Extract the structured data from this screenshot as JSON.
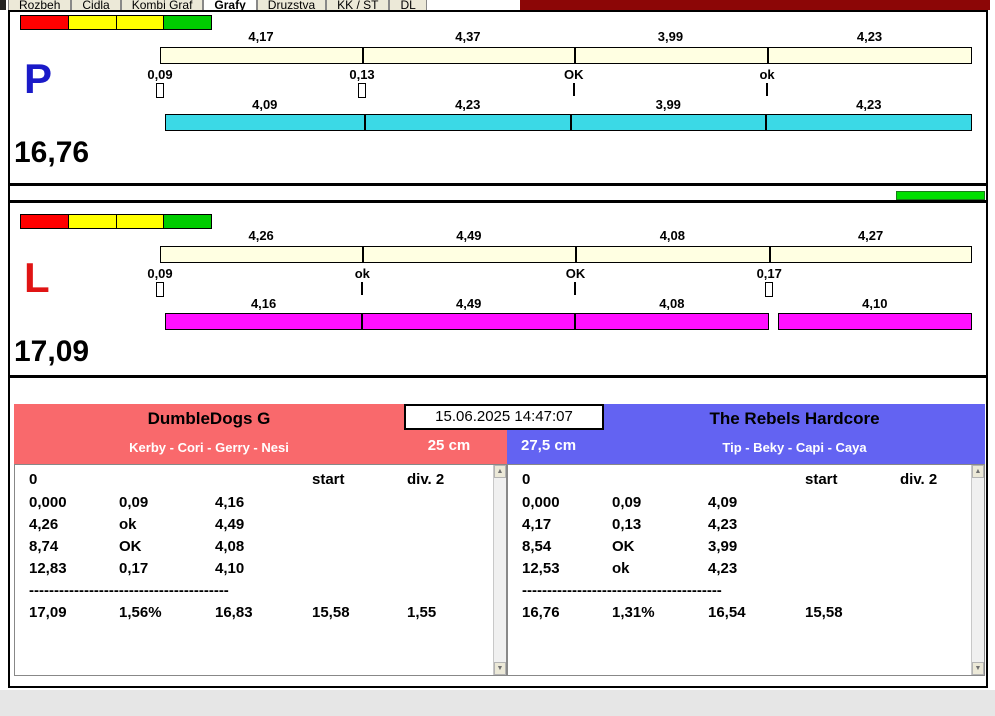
{
  "tabs": [
    {
      "label": "Rozbeh",
      "active": false
    },
    {
      "label": "Cidla",
      "active": false
    },
    {
      "label": "Kombi Graf",
      "active": false
    },
    {
      "label": "Grafy",
      "active": true
    },
    {
      "label": "Druzstva",
      "active": false
    },
    {
      "label": "KK / ST",
      "active": false
    },
    {
      "label": "DL",
      "active": false
    }
  ],
  "legend_colors": [
    "#ff0000",
    "#ffff00",
    "#ffff00",
    "#00cc00"
  ],
  "green_bar_color": "#00df00",
  "icons": {
    "scroll_up": "▲",
    "scroll_down": "▼"
  },
  "panels": [
    {
      "letter": "P",
      "letter_color": "#1a1ac8",
      "total": "16,76",
      "top_values": [
        "4,17",
        "4,37",
        "3,99",
        "4,23"
      ],
      "top_numeric": [
        4.17,
        4.37,
        3.99,
        4.23
      ],
      "top_bar_color": "#ffffe2",
      "marks": [
        {
          "label": "0,09",
          "glyph": "box"
        },
        {
          "label": "0,13",
          "glyph": "box"
        },
        {
          "label": "OK",
          "glyph": "line"
        },
        {
          "label": "ok",
          "glyph": "line"
        }
      ],
      "bottom_values": [
        "4,09",
        "4,23",
        "3,99",
        "4,23"
      ],
      "bottom_numeric": [
        4.09,
        4.23,
        3.99,
        4.23
      ],
      "bottom_bar_color": "#3bd9e6",
      "bottom_gap_after": -1
    },
    {
      "letter": "L",
      "letter_color": "#e01414",
      "total": "17,09",
      "top_values": [
        "4,26",
        "4,49",
        "4,08",
        "4,27"
      ],
      "top_numeric": [
        4.26,
        4.49,
        4.08,
        4.27
      ],
      "top_bar_color": "#ffffe2",
      "marks": [
        {
          "label": "0,09",
          "glyph": "box"
        },
        {
          "label": "ok",
          "glyph": "line"
        },
        {
          "label": "OK",
          "glyph": "line"
        },
        {
          "label": "0,17",
          "glyph": "box"
        }
      ],
      "bottom_values": [
        "4,16",
        "4,49",
        "4,08",
        "4,10"
      ],
      "bottom_numeric": [
        4.16,
        4.49,
        4.08,
        4.1
      ],
      "bottom_bar_color": "#ff10ff",
      "bottom_gap_after": 2
    }
  ],
  "timestamp": "15.06.2025 14:47:07",
  "teams": {
    "left": {
      "name": "DumbleDogs G",
      "dogs": "Kerby - Cori - Gerry - Nesi",
      "height": "25 cm",
      "header_color": "#f9696c",
      "table": {
        "header": [
          "0",
          "",
          "",
          "start",
          "div. 2"
        ],
        "rows": [
          [
            "0,000",
            "0,09",
            "4,16",
            "",
            ""
          ],
          [
            "4,26",
            "ok",
            "4,49",
            "",
            ""
          ],
          [
            "8,74",
            "OK",
            "4,08",
            "",
            ""
          ],
          [
            "12,83",
            "0,17",
            "4,10",
            "",
            ""
          ]
        ],
        "divider": "----------------------------------------",
        "totals": [
          "17,09",
          "1,56%",
          "16,83",
          "15,58",
          "1,55"
        ]
      }
    },
    "right": {
      "name": "The Rebels Hardcore",
      "dogs": "Tip - Beky - Capi - Caya",
      "height": "27,5 cm",
      "header_color": "#6363f2",
      "table": {
        "header": [
          "0",
          "",
          "",
          "start",
          "div. 2"
        ],
        "rows": [
          [
            "0,000",
            "0,09",
            "4,09",
            "",
            ""
          ],
          [
            "4,17",
            "0,13",
            "4,23",
            "",
            ""
          ],
          [
            "8,54",
            "OK",
            "3,99",
            "",
            ""
          ],
          [
            "12,53",
            "ok",
            "4,23",
            "",
            ""
          ]
        ],
        "divider": "----------------------------------------",
        "totals": [
          "16,76",
          "1,31%",
          "16,54",
          "15,58",
          ""
        ]
      }
    }
  }
}
